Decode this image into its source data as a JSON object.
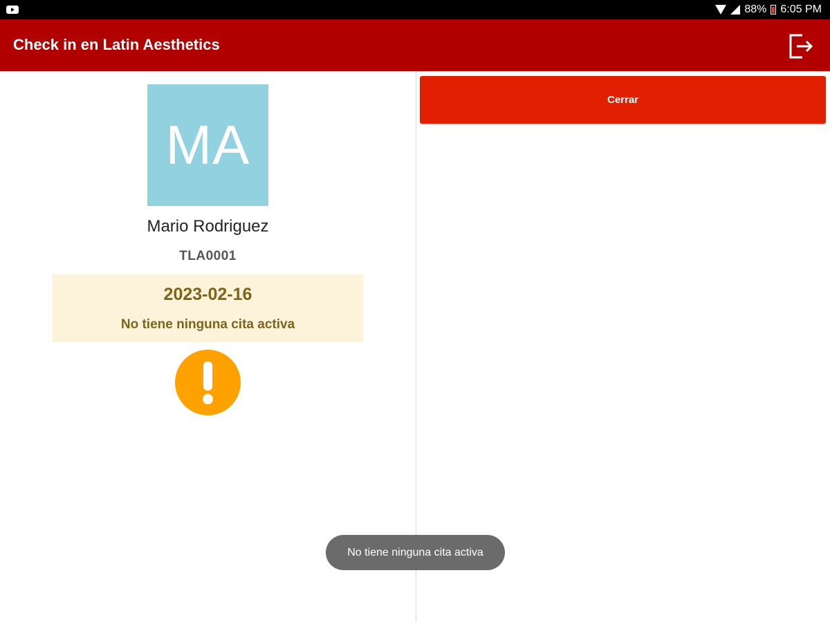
{
  "status_bar": {
    "notification_icon": "youtube-icon",
    "wifi_icon": "wifi-icon",
    "signal_icon": "signal-icon",
    "battery_icon": "battery-icon",
    "battery_level": "88%",
    "time": "6:05 PM"
  },
  "app_bar": {
    "title": "Check in en Latin Aesthetics",
    "action_icon": "logout-icon",
    "background_color": "#b10000"
  },
  "patient": {
    "initials": "MA",
    "avatar_color": "#92d2e0",
    "name": "Mario Rodriguez",
    "id": "TLA0001"
  },
  "appointment_box": {
    "date": "2023-02-16",
    "message": "No tiene ninguna cita activa",
    "background_color": "#fdf3db",
    "text_color": "#7c6418"
  },
  "alert": {
    "icon": "warning-exclamation-icon",
    "color": "#ffa200"
  },
  "right_panel": {
    "close_button_label": "Cerrar",
    "close_button_color": "#e02000"
  },
  "toast": {
    "message": "No tiene ninguna cita activa"
  }
}
